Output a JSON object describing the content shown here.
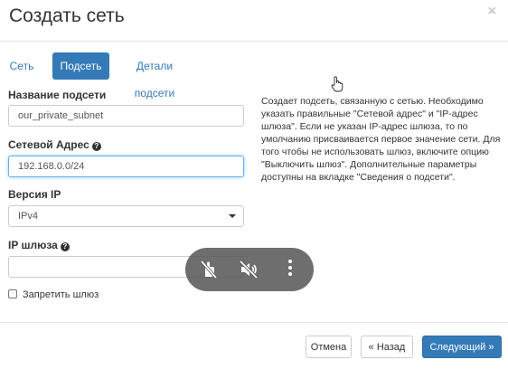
{
  "dialog": {
    "title": "Создать сеть",
    "close_glyph": "×"
  },
  "tabs": [
    {
      "label": "Сеть",
      "active": false
    },
    {
      "label": "Подсеть",
      "active": true
    },
    {
      "label": "Детали подсети",
      "active": false
    }
  ],
  "form": {
    "subnet_name": {
      "label": "Название подсети",
      "value": "our_private_subnet"
    },
    "network_address": {
      "label": "Сетевой Адрес",
      "value": "192.168.0.0/24",
      "help_glyph": "?"
    },
    "ip_version": {
      "label": "Версия IP",
      "value": "IPv4"
    },
    "gateway_ip": {
      "label": "IP шлюза",
      "value": "",
      "help_glyph": "?"
    },
    "disable_gateway": {
      "label": "Запретить шлюз",
      "checked": false
    }
  },
  "description": "Создает подсеть, связанную с сетью. Необходимо указать правильные \"Сетевой адрес\" и \"IP-адрес шлюза\". Если не указан IP-адрес шлюза, то по умолчанию присваивается первое значение сети. Для того чтобы не использовать шлюз, включите опцию \"Выключить шлюз\". Дополнительные параметры доступны на вкладке \"Сведения о подсети\".",
  "footer": {
    "cancel_label": "Отмена",
    "back_label": "« Назад",
    "next_label": "Следующий »"
  },
  "overlay": {
    "icons": [
      "hand-off-icon",
      "mute-icon",
      "more-vertical-icon"
    ]
  },
  "colors": {
    "primary": "#337ab7",
    "focus_border": "#66afe9",
    "overlay_bg": "#555555"
  }
}
